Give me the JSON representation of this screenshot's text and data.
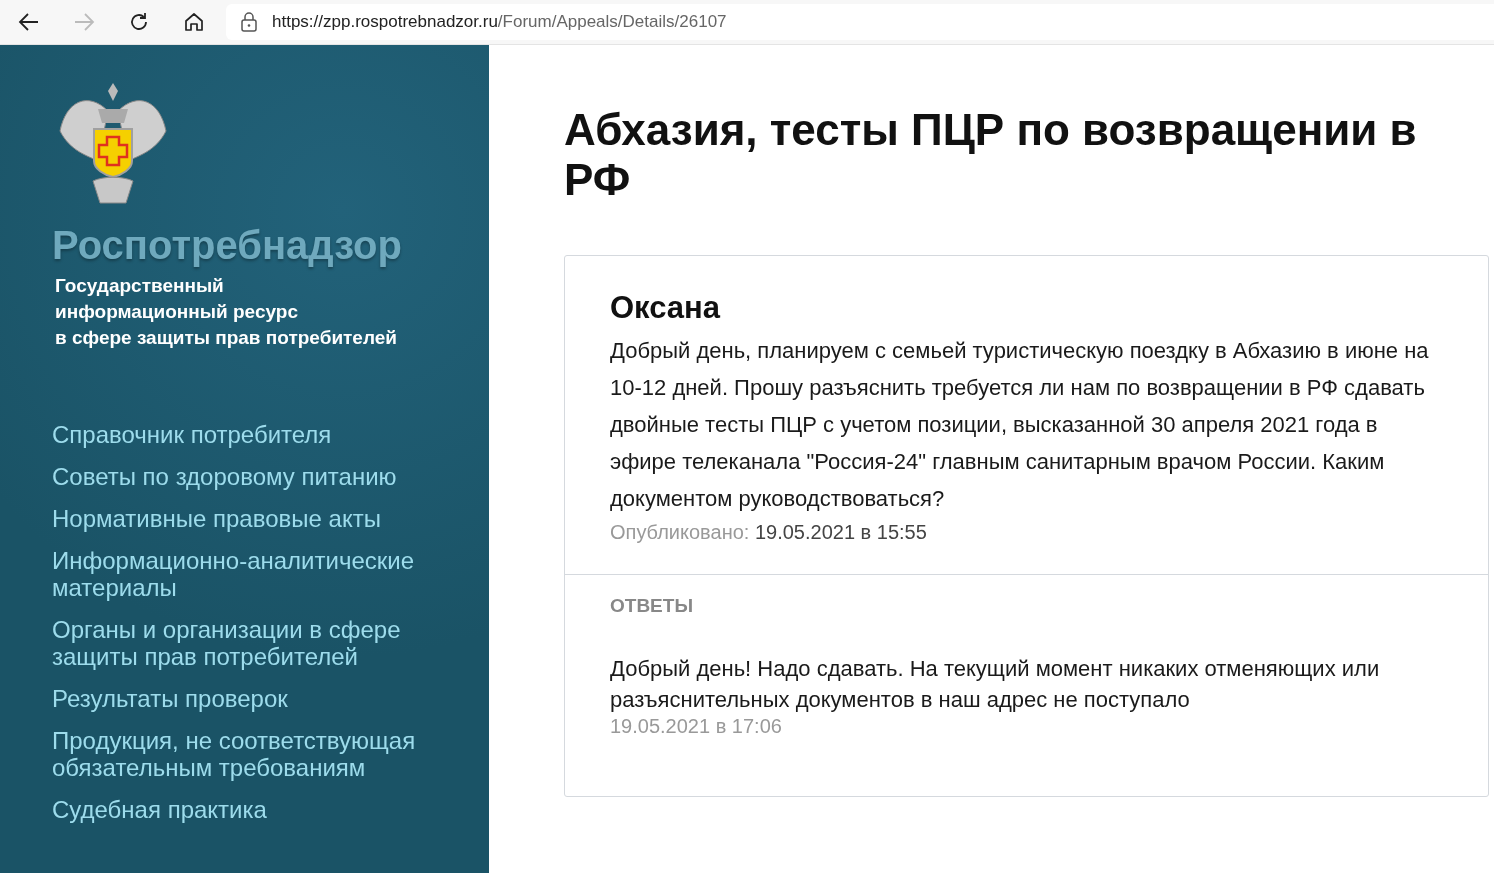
{
  "browser": {
    "url_host": "https://zpp.rospotrebnadzor.ru",
    "url_path": "/Forum/Appeals/Details/26107",
    "forward_disabled": true
  },
  "sidebar": {
    "brand": "Роспотребнадзор",
    "subtitle_lines": [
      "Государственный",
      "информационный ресурс",
      "в сфере защиты прав потребителей"
    ],
    "nav": [
      {
        "label": "Справочник потребителя"
      },
      {
        "label": "Советы по здоровому питанию"
      },
      {
        "label": "Нормативные правовые акты"
      },
      {
        "label": "Информационно-аналитические материалы"
      },
      {
        "label": "Органы и организации в сфере защиты прав потребителей"
      },
      {
        "label": "Результаты проверок"
      },
      {
        "label": "Продукция, не соответствующая обязательным требованиям"
      },
      {
        "label": "Судебная практика"
      }
    ]
  },
  "page": {
    "title": "Абхазия, тесты ПЦР по возвращении в РФ"
  },
  "question": {
    "author": "Оксана",
    "text": "Добрый день, планируем с семьей туристическую поездку в Абхазию в июне на 10-12 дней. Прошу разъяснить требуется ли нам по возвращении в РФ сдавать двойные тесты ПЦР с учетом позиции, высказанной 30 апреля 2021 года в эфире телеканала \"Россия-24\" главным санитарным врачом России. Каким документом руководствоваться?",
    "published_label": "Опубликовано:",
    "published_date": "19.05.2021 в 15:55"
  },
  "answers": {
    "heading": "ОТВЕТЫ",
    "items": [
      {
        "text": "Добрый день! Надо сдавать. На текущий момент никаких отменяющих или разъяснительных документов в наш адрес не поступало",
        "date": "19.05.2021 в 17:06"
      }
    ]
  }
}
